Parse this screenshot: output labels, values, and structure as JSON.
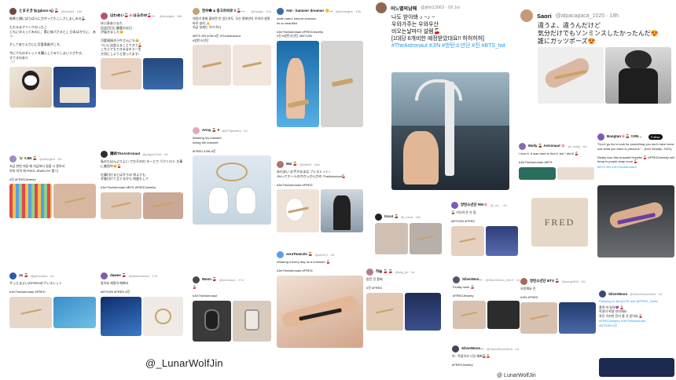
{
  "tweets": [
    {
      "name": "とまそき🐈‍⬛(gbsm-sj) 🍒",
      "handle": "@w•r8jrd · 10h",
      "text": "結果と鍋にばらばらにかかってたこしさしましみる🍒\n\nただるまアリンクのったこ\nじもにゆえってみのに、実に味パさるとこ 日本ばかりに、 あっ…\n\nそしてありえさにに可愛過過ぎじす。\n\n今にでものタレットを購入してみてしまいうさやす。\nすてきのあり\n（ ）"
    },
    {
      "name": "ほわめい🍒🌸はるのゆ🍒Fan of BTS",
      "handle": "@emegka · 16h",
      "text": "ゆぶ多ありまた\n記念目日に最愛のお日\nが届きました😊\n\n可愛過過ぎ小牛さんにも😊\nついに出会えることできて🍒\nこちらでもできるはキラ一生\n大切にしようと思ってます♪"
    },
    {
      "name": "현우✿ & 종고르바로 \\\\ 🍒🍒🍒",
      "handle": "@nwajin · 12h",
      "text": "데일리 팔찌 불완전 안 있는지도, 무슨 팔찌만다 우리의 설명 바로 살지 👍\n지금 실제는 우리 하나 \n\n#BTS JIN #JIN #진 #TheAstronaut\n#방탄소년단"
    },
    {
      "name": "ANI - hammer dreamer 🌼🍒",
      "handle": "@duriangbe · 13h",
      "text": "woah hand, stunnin woooah\nIts so beautiful\n\n#JinTheAstronaut #FREDJewelry\n#진 #방탄소년단 #BTSJIN"
    },
    {
      "name": "Saori",
      "handle": "@alpacapaca_1025 · 18h",
      "text": "違うよ、違うんだけど\n気分だけでもソンミンスしたかったんだ😍\n誰にガッツポーズ😍"
    },
    {
      "name": "レクション",
      "handle": "@w••k_5e · 21h",
      "text": "大阪で行のはじめの\nらすのアクセサリ購入\n\n#BTS #JIN #TheAstronaut\n#FREDJewelry"
    },
    {
      "name": "鶏肉TheAstronaut",
      "handle": "@pagoe1234 · 4d",
      "text": "私のたはんよりよい でひそのの ネーとで パクトロミ 大事に着用中🌼🍒\n\n仕事付けるとばかりの 何よりも\nダ意付けて立てるから 何度もして\n\n#JinTheAstronaut #BTS #FREDJewelry"
    },
    {
      "name": "Army 🍒 ♥",
      "handle": "@BTSjewelry · 1d",
      "text": "Wearing my bracelet\nloving the bracelet\n\n#FRED #JIN #진"
    },
    {
      "name": "Mai 🍒",
      "handle": "@Mai13 · 20d",
      "text": "あわあい お手がままは ブレスレット♪\nJINってホールのかかっからかの TheAstronaut🍒\n\n#JinTheAstronaut #FRED"
    },
    {
      "name": "🦖 #JIN 🍒",
      "handle": "@A6onjinh · 3d",
      "text": "지금 한번 처음 때 지금보다 일을 시 알아서\n아미 자격 에 FRED JEWELRY 를 다\n\n#진 #FREDJewelry"
    },
    {
      "name": "Jo 🍒",
      "handle": "@jotheastro · 5d",
      "text": "ずっとまよいのFREDのブレスレット\n\n#JinTheAstronaut #FRED"
    },
    {
      "name": "dawee 🍒",
      "handle": "@daweewewa · 27d",
      "text": "맞아요 재질이 예뻐서\n\n#BTSJIN #FRED #진"
    },
    {
      "name": "Moon 🍒",
      "handle": "@mmmoon · 27d",
      "text": "🍒\n\n#JinTheAstronaut"
    },
    {
      "name": "seraTeamJin 🍒",
      "handle": "@seraTJ · 2d",
      "text": "Wearing it every day as a reminder 🍒\n\n#JinTheAstronaut #FRED"
    },
    {
      "name": "tricot 🍒",
      "handle": "@_tricot · 22h",
      "text": "Gifted to myself\n\n#JinTheAstronaut #FREDJewelry"
    },
    {
      "name": "하늘 🍒 🍒",
      "handle": "@sky_jin · 1d",
      "text": "방탄 진 팔찌\n\n#진 #FRED"
    },
    {
      "name": "Nina 🍒",
      "handle": "@nina_jin · 4d",
      "text": "Got it!\n\n#FREDJewelry #JIN"
    }
  ],
  "right_tweets": [
    {
      "name": "Molly 🍒 Astronaut 🌸",
      "handle": "@_molly · 6d",
      "text": "I love it. It was hard to find it, but I did it! 🍒\n\n#JinTheAstronaut #BTS"
    },
    {
      "name": "방탄소년단 RM🌸",
      "handle": "@_rm_ · 2d",
      "text": "🍒 기다려 온 가 힘\n\n#BTSJIN #FRED"
    },
    {
      "name": "SilverMoon 🍒",
      "handle": "@SilverMoon_0815 · 1d",
      "text": "Finally mine 🍒\n\n#FREDJewelry"
    },
    {
      "name": "TaeKook 💜",
      "handle": "@tk_jin · 3h",
      "text": "Tuesday Jin\n\n#FRED #JinTheAstronaut"
    },
    {
      "name": "SilverMoon 🍒",
      "handle": "@SilverMoon0815 · 1d",
      "text": "아~ 목걸이가 너무 예뻐🍒🍒\n\n#FREDJewelry"
    },
    {
      "name": "방탄소년단 BTS 🍒",
      "handle": "@song0815 · 6d",
      "text": "사랑해요 진\n\n#JIN #FRED"
    }
  ],
  "featured_korean": {
    "name": "어느별의남해",
    "handle": "@jiilin13063 · 09 Jul",
    "text": "나도 받아봐 ♪ ~♪ ~\n우와가주는 우와우산\n비오는날마다 설렘🍒\n[1대당 6개비한 예정받았대요!! 허허허허]",
    "tags": "#TheAstronaut #JIN #방탄소년단 #진 #BTS_twt"
  },
  "featured_right": {
    "name": "Saori",
    "handle": "@alpacapaca_1025 · 18h",
    "text": "違うよ、違うんだけど\n気分だけでもソンミンスしたかったんだ😍\n誰にガッツポーズ😍"
  },
  "featured_quote": {
    "name": "Bangtan🌸🍒 #JIN🎀 BTS🎀",
    "handle": "@bangtan_93",
    "follow": "Follow",
    "text": "\"Don't go far to look for something you don't have because what you have is precious.\" - (Kim Seokjin, 2021)\n\nReally love this bracelet Hopeful 🍒 #FREDJewelry will bring in purple strap soon 🍒",
    "tags": "#BTS JIN #JinTheAstronaut"
  },
  "featured_silvermoon": {
    "name": "SilverMoon",
    "handle": "@SilverMoon0815 · 1d",
    "reply": "Replying to @ruj1476 and @FRED_Jewel",
    "text": "찰떡 마 달아💜 🍒\n목걸이 착용 선미해요\n작은 거지만 진이 즐 것 같아요 🍒",
    "tags": "#FREDJewelry #JinTheAstronaut\n#BTSJIN #진"
  },
  "watermark": "@_LunarWolfJin",
  "watermark_small": "@ LunarWolfJin",
  "brand_box": "FRED",
  "colors": {
    "link": "#1d9bf0",
    "bracelet": "#c9a36a"
  }
}
